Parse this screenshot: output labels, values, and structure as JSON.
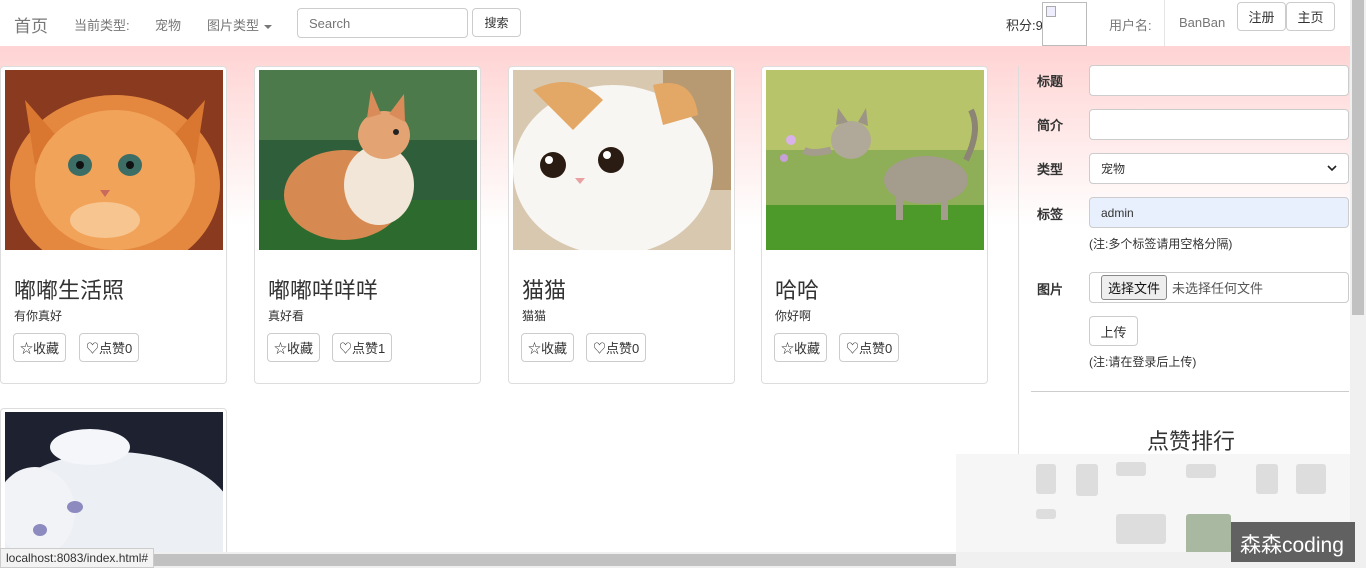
{
  "navbar": {
    "brand": "首页",
    "current_type_label": "当前类型:",
    "current_type_value": "宠物",
    "image_type_menu": "图片类型",
    "search_placeholder": "Search",
    "search_button": "搜索",
    "points_label": "积分:9",
    "username_label": "用户名:",
    "username": "BanBan",
    "register_button": "注册",
    "home_button": "主页"
  },
  "cards": [
    {
      "title": "嘟嘟生活照",
      "desc": "有你真好",
      "collect_label": "☆收藏",
      "like_label": "♡点赞0",
      "image": "orange-fluffy-kitten-photo"
    },
    {
      "title": "嘟嘟咩咩咩",
      "desc": "真好看",
      "collect_label": "☆收藏",
      "like_label": "♡点赞1",
      "image": "ginger-kitten-on-grass-photo"
    },
    {
      "title": "猫猫",
      "desc": "猫猫",
      "collect_label": "☆收藏",
      "like_label": "♡点赞0",
      "image": "white-round-cat-photo"
    },
    {
      "title": "哈哈",
      "desc": "你好啊",
      "collect_label": "☆收藏",
      "like_label": "♡点赞0",
      "image": "tabby-kitten-with-flower-photo"
    },
    {
      "image": "white-cat-lying-photo"
    }
  ],
  "form": {
    "title_label": "标题",
    "title_value": "",
    "intro_label": "简介",
    "intro_value": "",
    "type_label": "类型",
    "type_value": "宠物",
    "tag_label": "标签",
    "tag_value": "admin",
    "tag_note": "(注:多个标签请用空格分隔)",
    "image_label": "图片",
    "choose_file_button": "选择文件",
    "no_file_text": "未选择任何文件",
    "upload_button": "上传",
    "upload_note": "(注:请在登录后上传)"
  },
  "ranking": {
    "title": "点赞排行"
  },
  "status_bar": {
    "url": "localhost:8083/index.html#"
  },
  "watermark": "森森coding"
}
